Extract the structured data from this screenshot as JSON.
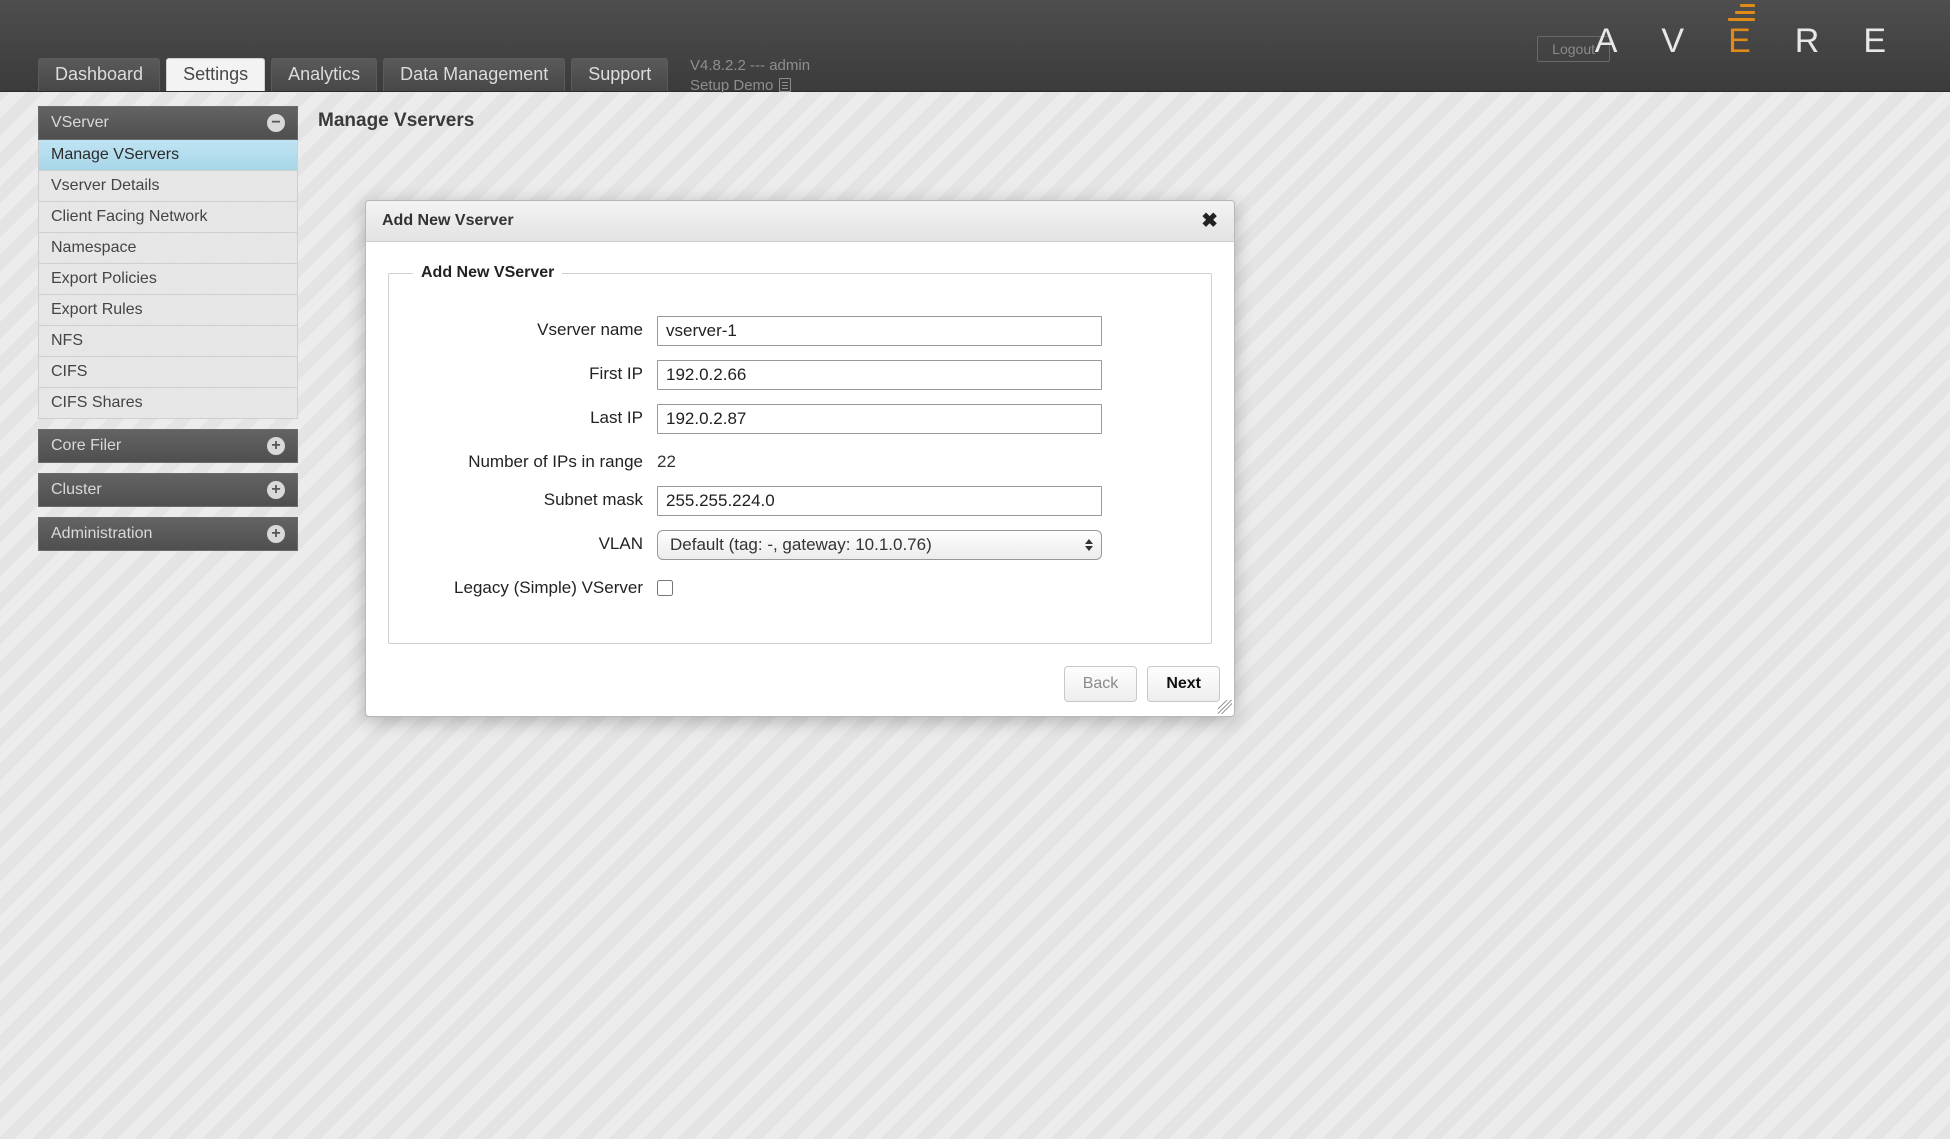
{
  "header": {
    "logout_label": "Logout",
    "version_text": "V4.8.2.2 --- admin",
    "setup_label": "Setup Demo",
    "logo_letters": [
      "A",
      "V",
      "E",
      "R",
      "E"
    ]
  },
  "nav": {
    "tabs": [
      {
        "label": "Dashboard"
      },
      {
        "label": "Settings"
      },
      {
        "label": "Analytics"
      },
      {
        "label": "Data Management"
      },
      {
        "label": "Support"
      }
    ],
    "active_index": 1
  },
  "sidebar": {
    "sections": [
      {
        "label": "VServer",
        "expanded": true,
        "toggle_glyph": "−",
        "items": [
          {
            "label": "Manage VServers",
            "active": true
          },
          {
            "label": "Vserver Details"
          },
          {
            "label": "Client Facing Network"
          },
          {
            "label": "Namespace"
          },
          {
            "label": "Export Policies"
          },
          {
            "label": "Export Rules"
          },
          {
            "label": "NFS"
          },
          {
            "label": "CIFS"
          },
          {
            "label": "CIFS Shares"
          }
        ]
      },
      {
        "label": "Core Filer",
        "expanded": false,
        "toggle_glyph": "+"
      },
      {
        "label": "Cluster",
        "expanded": false,
        "toggle_glyph": "+"
      },
      {
        "label": "Administration",
        "expanded": false,
        "toggle_glyph": "+"
      }
    ]
  },
  "page": {
    "title": "Manage Vservers"
  },
  "dialog": {
    "title": "Add New Vserver",
    "close_glyph": "✖",
    "legend": "Add New VServer",
    "fields": {
      "vserver_name_label": "Vserver name",
      "vserver_name_value": "vserver-1",
      "first_ip_label": "First IP",
      "first_ip_value": "192.0.2.66",
      "last_ip_label": "Last IP",
      "last_ip_value": "192.0.2.87",
      "num_ips_label": "Number of IPs in range",
      "num_ips_value": "22",
      "subnet_label": "Subnet mask",
      "subnet_value": "255.255.224.0",
      "vlan_label": "VLAN",
      "vlan_value": "Default (tag: -, gateway: 10.1.0.76)",
      "legacy_label": "Legacy (Simple) VServer",
      "legacy_checked": false
    },
    "buttons": {
      "back": "Back",
      "next": "Next"
    }
  }
}
